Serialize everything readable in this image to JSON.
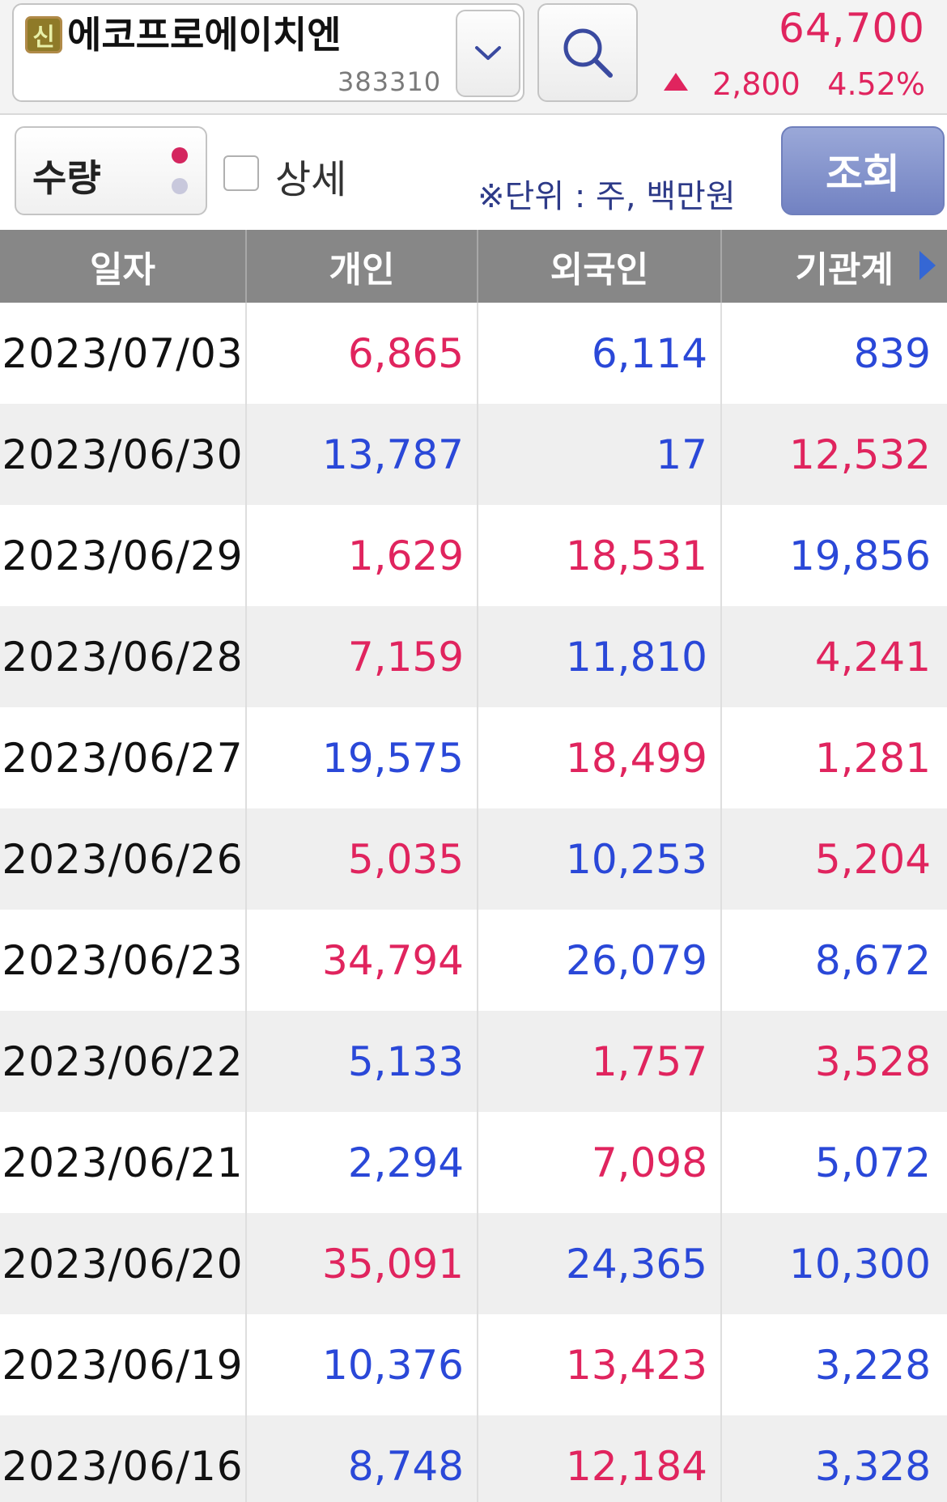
{
  "stock": {
    "badge": "신",
    "name": "에코프로에이치엔",
    "code": "383310",
    "price": "64,700",
    "change": "2,800",
    "rate": "4.52%"
  },
  "options": {
    "type_label": "수량",
    "detail_label": "상세",
    "unit_note": "※단위 : 주, 백만원",
    "query_label": "조회"
  },
  "table": {
    "headers": [
      "일자",
      "개인",
      "외국인",
      "기관계"
    ],
    "rows": [
      {
        "date": "2023/07/03",
        "individual": "6,865",
        "individual_color": "red",
        "foreign": "6,114",
        "foreign_color": "blue",
        "institution": "839",
        "institution_color": "blue"
      },
      {
        "date": "2023/06/30",
        "individual": "13,787",
        "individual_color": "blue",
        "foreign": "17",
        "foreign_color": "blue",
        "institution": "12,532",
        "institution_color": "red"
      },
      {
        "date": "2023/06/29",
        "individual": "1,629",
        "individual_color": "red",
        "foreign": "18,531",
        "foreign_color": "red",
        "institution": "19,856",
        "institution_color": "blue"
      },
      {
        "date": "2023/06/28",
        "individual": "7,159",
        "individual_color": "red",
        "foreign": "11,810",
        "foreign_color": "blue",
        "institution": "4,241",
        "institution_color": "red"
      },
      {
        "date": "2023/06/27",
        "individual": "19,575",
        "individual_color": "blue",
        "foreign": "18,499",
        "foreign_color": "red",
        "institution": "1,281",
        "institution_color": "red"
      },
      {
        "date": "2023/06/26",
        "individual": "5,035",
        "individual_color": "red",
        "foreign": "10,253",
        "foreign_color": "blue",
        "institution": "5,204",
        "institution_color": "red"
      },
      {
        "date": "2023/06/23",
        "individual": "34,794",
        "individual_color": "red",
        "foreign": "26,079",
        "foreign_color": "blue",
        "institution": "8,672",
        "institution_color": "blue"
      },
      {
        "date": "2023/06/22",
        "individual": "5,133",
        "individual_color": "blue",
        "foreign": "1,757",
        "foreign_color": "red",
        "institution": "3,528",
        "institution_color": "red"
      },
      {
        "date": "2023/06/21",
        "individual": "2,294",
        "individual_color": "blue",
        "foreign": "7,098",
        "foreign_color": "red",
        "institution": "5,072",
        "institution_color": "blue"
      },
      {
        "date": "2023/06/20",
        "individual": "35,091",
        "individual_color": "red",
        "foreign": "24,365",
        "foreign_color": "blue",
        "institution": "10,300",
        "institution_color": "blue"
      },
      {
        "date": "2023/06/19",
        "individual": "10,376",
        "individual_color": "blue",
        "foreign": "13,423",
        "foreign_color": "red",
        "institution": "3,228",
        "institution_color": "blue"
      },
      {
        "date": "2023/06/16",
        "individual": "8,748",
        "individual_color": "blue",
        "foreign": "12,184",
        "foreign_color": "red",
        "institution": "3,328",
        "institution_color": "blue"
      }
    ]
  },
  "colors": {
    "up": "#e0245e",
    "down": "#2a48d8",
    "header_bg": "#878787",
    "query_button": "#7f8ec8"
  },
  "icons": {
    "dropdown": "chevron-down-icon",
    "search": "search-icon",
    "price_direction": "triangle-up-icon",
    "next_columns": "triangle-right-icon"
  }
}
